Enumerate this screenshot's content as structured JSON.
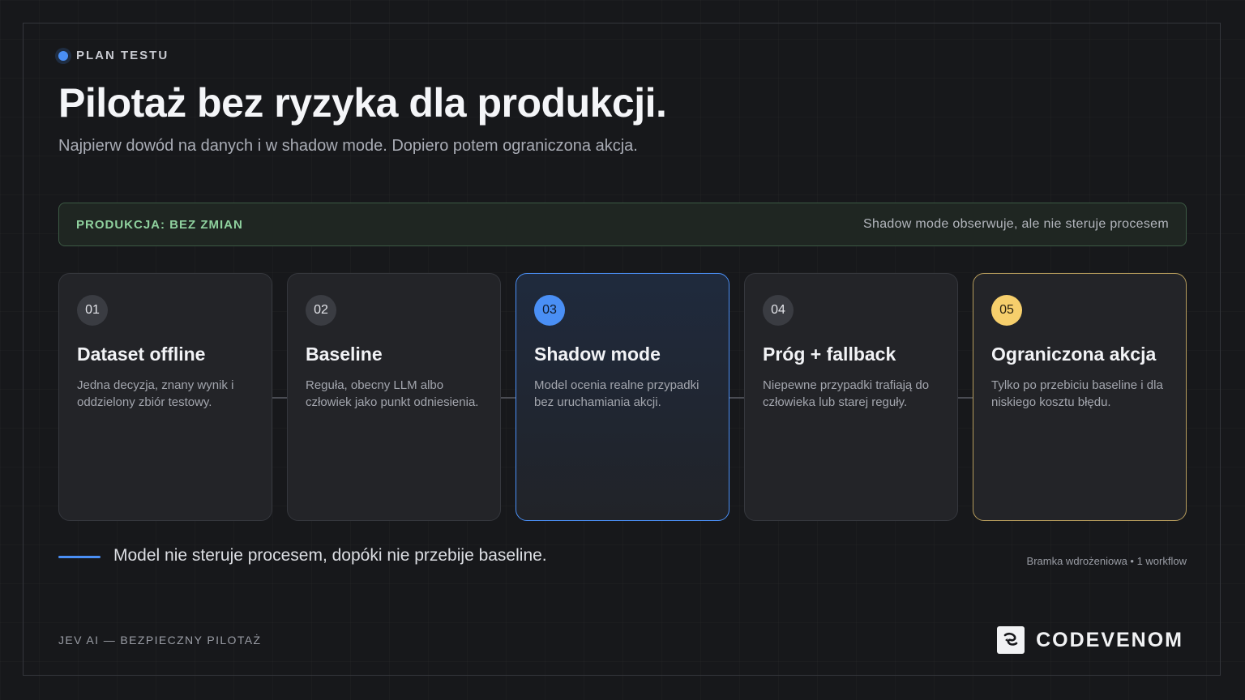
{
  "header": {
    "eyebrow": "PLAN TESTU",
    "title": "Pilotaż bez ryzyka dla produkcji.",
    "subtitle": "Najpierw dowód na danych i w shadow mode. Dopiero potem ograniczona akcja."
  },
  "production_banner": {
    "label": "PRODUKCJA: BEZ ZMIAN",
    "note": "Shadow mode obserwuje, ale nie steruje procesem"
  },
  "steps": [
    {
      "number": "01",
      "title": "Dataset offline",
      "description": "Jedna decyzja, znany wynik i oddzielony zbiór testowy."
    },
    {
      "number": "02",
      "title": "Baseline",
      "description": "Reguła, obecny LLM albo człowiek jako punkt odniesienia."
    },
    {
      "number": "03",
      "title": "Shadow mode",
      "description": "Model ocenia realne przypadki bez uruchamiania akcji."
    },
    {
      "number": "04",
      "title": "Próg + fallback",
      "description": "Niepewne przypadki trafiają do człowieka lub starej reguły."
    },
    {
      "number": "05",
      "title": "Ograniczona akcja",
      "description": "Tylko po przebiciu baseline i dla niskiego kosztu błędu."
    }
  ],
  "callout": {
    "text": "Model nie steruje procesem, dopóki nie przebije baseline.",
    "meta": "Bramka wdrożeniowa • 1 workflow"
  },
  "footer": {
    "left": "JEV AI — BEZPIECZNY PILOTAŻ",
    "brand": "CODEVENOM",
    "brand_icon": "codevenom-logo-icon"
  },
  "colors": {
    "background": "#17181b",
    "accent_blue": "#4a8ff5",
    "accent_yellow": "#f6cf6c",
    "accent_green": "#8fd19e"
  }
}
